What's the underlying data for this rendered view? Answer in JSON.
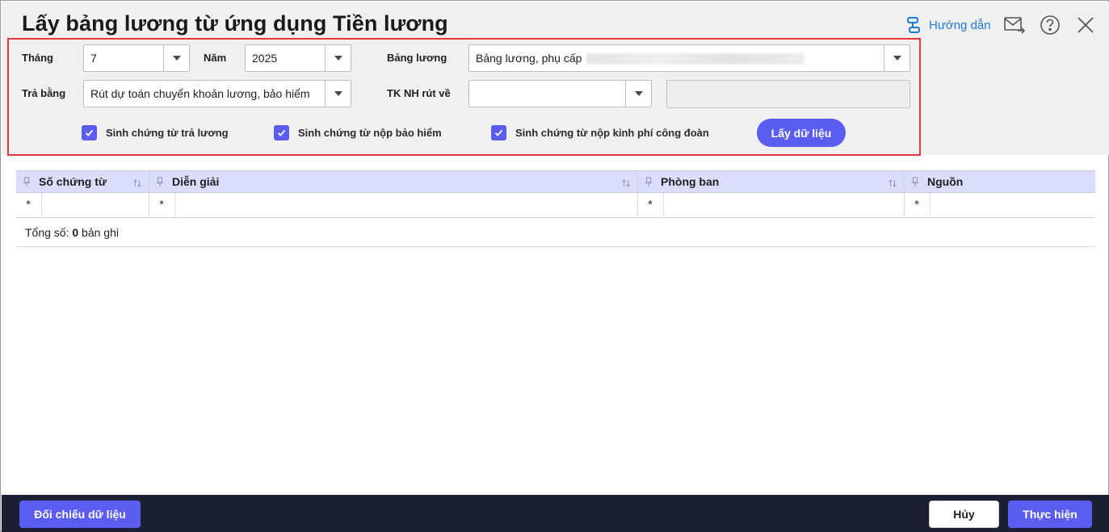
{
  "dialog": {
    "title": "Lấy bảng lương từ ứng dụng Tiền lương",
    "help_label": "Hướng dẫn"
  },
  "form": {
    "month_label": "Tháng",
    "month_value": "7",
    "year_label": "Năm",
    "year_value": "2025",
    "payroll_label": "Bảng lương",
    "payroll_value": "Bảng lương, phụ cấp",
    "pay_by_label": "Trả bằng",
    "pay_by_value": "Rút dự toán chuyển khoản lương, bảo hiểm",
    "bank_label": "TK NH rút về",
    "bank_value": "",
    "bank_name_value": "",
    "checkboxes": [
      {
        "label": "Sinh chứng từ trả lương",
        "checked": true
      },
      {
        "label": "Sinh chứng từ nộp bảo hiểm",
        "checked": true
      },
      {
        "label": "Sinh chứng từ nộp kinh phí công đoàn",
        "checked": true
      }
    ],
    "fetch_button": "Lấy dữ liệu"
  },
  "grid": {
    "columns": [
      "Số chứng từ",
      "Diễn giải",
      "Phòng ban",
      "Nguồn"
    ],
    "filter_symbol": "*",
    "total_prefix": "Tổng số: ",
    "total_count": "0",
    "total_suffix": " bản ghi"
  },
  "footer": {
    "compare_button": "Đối chiếu dữ liệu",
    "cancel_button": "Hủy",
    "execute_button": "Thực hiện"
  },
  "colors": {
    "accent": "#5b5cf0",
    "highlight_border": "#e5353d",
    "footer_bg": "#1d1f33",
    "link": "#1b7bd8",
    "grid_header": "#dcdcfc"
  }
}
